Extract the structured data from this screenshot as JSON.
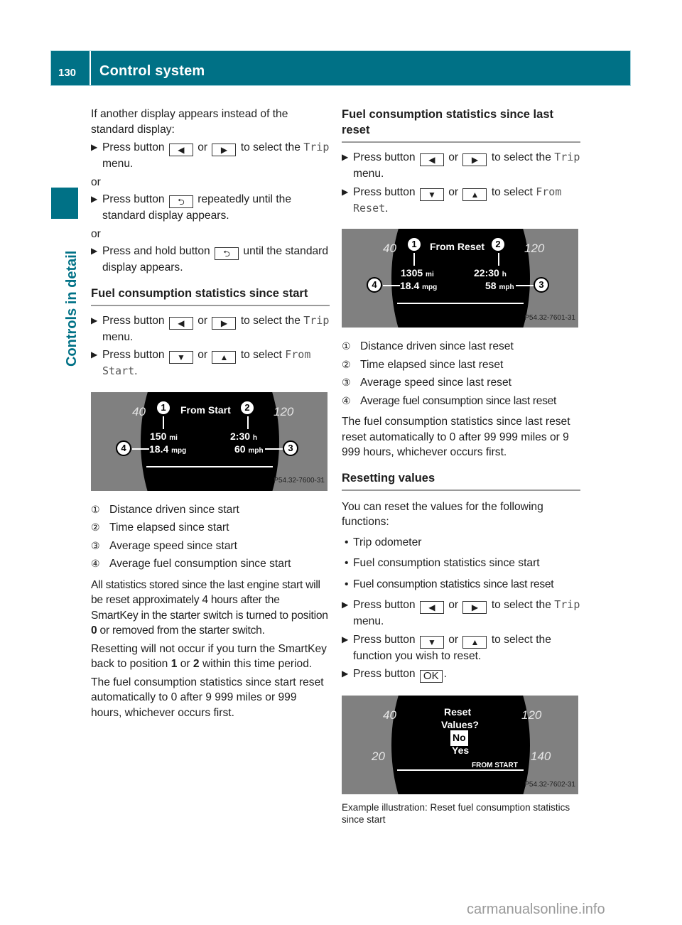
{
  "header": {
    "page_number": "130",
    "title": "Control system"
  },
  "sidebar": {
    "label": "Controls in detail"
  },
  "left": {
    "intro": "If another display appears instead of the standard display:",
    "steps_a": [
      {
        "pre": "Press button",
        "b1": "◀",
        "mid": "or",
        "b2": "▶",
        "post": "to select the",
        "mono": "Trip",
        "tail": "menu."
      }
    ],
    "or1": "or",
    "step_b": {
      "pre": "Press button",
      "b1": "⮌",
      "post": "repeatedly until the standard display appears."
    },
    "or2": "or",
    "step_c": {
      "pre": "Press and hold button",
      "b1": "⮌",
      "post": "until the standard display appears."
    },
    "heading": "Fuel consumption statistics since start",
    "steps": [
      {
        "pre": "Press button",
        "b1": "◀",
        "mid": "or",
        "b2": "▶",
        "post": "to select the",
        "mono": "Trip",
        "tail": "menu."
      },
      {
        "pre": "Press button",
        "b1": "▼",
        "mid": "or",
        "b2": "▲",
        "post": "to select",
        "mono": "From Start",
        "tail": "."
      }
    ],
    "figure": {
      "gauge_left": "40",
      "gauge_right": "120",
      "title": "From Start",
      "distance": "150",
      "distance_unit": "mi",
      "time": "2:30",
      "time_unit": "h",
      "fuel": "18.4",
      "fuel_unit": "mpg",
      "speed": "60",
      "speed_unit": "mph",
      "callouts": [
        "1",
        "2",
        "3",
        "4"
      ],
      "code": "P54.32-7600-31"
    },
    "legend": [
      {
        "num": "①",
        "text": "Distance driven since start"
      },
      {
        "num": "②",
        "text": "Time elapsed since start"
      },
      {
        "num": "③",
        "text": "Average speed since start"
      },
      {
        "num": "④",
        "text": "Average fuel consumption since start"
      }
    ],
    "para1_a": "All statistics stored since the last engine start will be reset approximately 4 hours after the SmartKey in the starter switch is turned to position ",
    "para1_b": "0",
    "para1_c": " or removed from the starter switch.",
    "para2_a": "Resetting will not occur if you turn the SmartKey back to position ",
    "para2_b": "1",
    "para2_c": " or ",
    "para2_d": "2",
    "para2_e": " within this time period.",
    "para3": "The fuel consumption statistics since start reset automatically to 0 after 9 999 miles or 999 hours, whichever occurs first."
  },
  "right": {
    "heading": "Fuel consumption statistics since last reset",
    "steps": [
      {
        "pre": "Press button",
        "b1": "◀",
        "mid": "or",
        "b2": "▶",
        "post": "to select the",
        "mono": "Trip",
        "tail": "menu."
      },
      {
        "pre": "Press button",
        "b1": "▼",
        "mid": "or",
        "b2": "▲",
        "post": "to select",
        "mono": "From Reset",
        "tail": "."
      }
    ],
    "figure": {
      "gauge_left": "40",
      "gauge_right": "120",
      "title": "From Reset",
      "distance": "1305",
      "distance_unit": "mi",
      "time": "22:30",
      "time_unit": "h",
      "fuel": "18.4",
      "fuel_unit": "mpg",
      "speed": "58",
      "speed_unit": "mph",
      "callouts": [
        "1",
        "2",
        "3",
        "4"
      ],
      "code": "P54.32-7601-31"
    },
    "legend": [
      {
        "num": "①",
        "text": "Distance driven since last reset"
      },
      {
        "num": "②",
        "text": "Time elapsed since last reset"
      },
      {
        "num": "③",
        "text": "Average speed since last reset"
      },
      {
        "num": "④",
        "text": "Average fuel consumption since last reset"
      }
    ],
    "para1": "The fuel consumption statistics since last reset reset automatically to 0 after 99 999 miles or 9 999 hours, whichever occurs first.",
    "heading2": "Resetting values",
    "para2": "You can reset the values for the following functions:",
    "bullets": [
      "Trip odometer",
      "Fuel consumption statistics since start",
      "Fuel consumption statistics since last reset"
    ],
    "steps2": [
      {
        "pre": "Press button",
        "b1": "◀",
        "mid": "or",
        "b2": "▶",
        "post": "to select the",
        "mono": "Trip",
        "tail": "menu."
      },
      {
        "pre": "Press button",
        "b1": "▼",
        "mid": "or",
        "b2": "▲",
        "post": "to select the function you wish to reset."
      },
      {
        "pre": "Press button",
        "b1": "OK",
        "tail": "."
      }
    ],
    "figure3": {
      "gauge_tl": "40",
      "gauge_tr": "120",
      "gauge_bl": "20",
      "gauge_br": "140",
      "line1": "Reset",
      "line2": "Values?",
      "opt_selected": "No",
      "opt_other": "Yes",
      "footer": "FROM START",
      "code": "P54.32-7602-31"
    },
    "caption": "Example illustration: Reset fuel consumption statistics since start"
  },
  "watermark": "carmanualsonline.info",
  "colors": {
    "brand": "#007186",
    "rule": "#9a9a9a"
  }
}
